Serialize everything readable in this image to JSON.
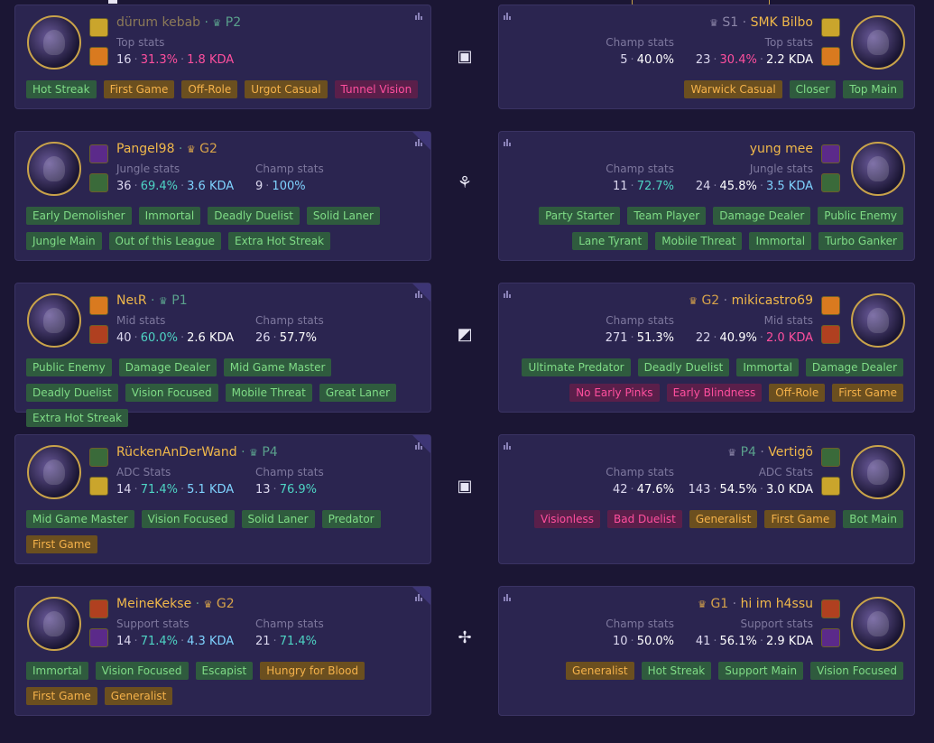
{
  "matchups": [
    {
      "role_glyph": "▣",
      "left": {
        "name": "dürum kebab",
        "rank": "P2",
        "rank_color": "#5aa08c",
        "name_dim": true,
        "role_label": "Top stats",
        "champ_label": "",
        "role_games": "16",
        "role_wr": "31.3%",
        "role_kda": "1.8 KDA",
        "champ_games": "",
        "champ_wr": "",
        "tags": [
          {
            "t": "Hot Streak",
            "c": "g"
          },
          {
            "t": "First Game",
            "c": "o"
          },
          {
            "t": "Off-Role",
            "c": "o"
          },
          {
            "t": "Urgot Casual",
            "c": "o"
          },
          {
            "t": "Tunnel Vision",
            "c": "p"
          }
        ]
      },
      "right": {
        "name": "SMK Bilbo",
        "rank": "S1",
        "rank_color": "#8c86a8",
        "role_label": "Top stats",
        "champ_label": "Champ stats",
        "role_games": "23",
        "role_wr": "30.4%",
        "role_kda": "2.2 KDA",
        "champ_games": "5",
        "champ_wr": "40.0%",
        "tags": [
          {
            "t": "Warwick Casual",
            "c": "o"
          },
          {
            "t": "Closer",
            "c": "g"
          },
          {
            "t": "Top Main",
            "c": "g"
          }
        ]
      }
    },
    {
      "role_glyph": "⚘",
      "left": {
        "name": "Pangel98",
        "rank": "G2",
        "role_label": "Jungle stats",
        "champ_label": "Champ stats",
        "role_games": "36",
        "role_wr": "69.4%",
        "role_kda": "3.6 KDA",
        "champ_games": "9",
        "champ_wr": "100%",
        "tags": [
          {
            "t": "Early Demolisher",
            "c": "g"
          },
          {
            "t": "Immortal",
            "c": "g"
          },
          {
            "t": "Deadly Duelist",
            "c": "g"
          },
          {
            "t": "Solid Laner",
            "c": "g"
          },
          {
            "t": "Jungle Main",
            "c": "g"
          },
          {
            "t": "Out of this League",
            "c": "g"
          },
          {
            "t": "Extra Hot Streak",
            "c": "g"
          }
        ]
      },
      "right": {
        "name": "yung mee",
        "rank": "",
        "role_label": "Jungle stats",
        "champ_label": "Champ stats",
        "role_games": "24",
        "role_wr": "45.8%",
        "role_kda": "3.5 KDA",
        "champ_games": "11",
        "champ_wr": "72.7%",
        "tags": [
          {
            "t": "Party Starter",
            "c": "g"
          },
          {
            "t": "Team Player",
            "c": "g"
          },
          {
            "t": "Damage Dealer",
            "c": "g"
          },
          {
            "t": "Public Enemy",
            "c": "g"
          },
          {
            "t": "Lane Tyrant",
            "c": "g"
          },
          {
            "t": "Mobile Threat",
            "c": "g"
          },
          {
            "t": "Immortal",
            "c": "g"
          },
          {
            "t": "Turbo Ganker",
            "c": "g"
          }
        ]
      }
    },
    {
      "role_glyph": "◩",
      "left": {
        "name": "NeιR",
        "rank": "P1",
        "role_label": "Mid stats",
        "champ_label": "Champ stats",
        "role_games": "40",
        "role_wr": "60.0%",
        "role_kda": "2.6 KDA",
        "champ_games": "26",
        "champ_wr": "57.7%",
        "tags": [
          {
            "t": "Public Enemy",
            "c": "g"
          },
          {
            "t": "Damage Dealer",
            "c": "g"
          },
          {
            "t": "Mid Game Master",
            "c": "g"
          },
          {
            "t": "Deadly Duelist",
            "c": "g"
          },
          {
            "t": "Vision Focused",
            "c": "g"
          },
          {
            "t": "Mobile Threat",
            "c": "g"
          },
          {
            "t": "Great Laner",
            "c": "g"
          },
          {
            "t": "Extra Hot Streak",
            "c": "g"
          }
        ]
      },
      "right": {
        "name": "mikicastro69",
        "rank": "G2",
        "role_label": "Mid stats",
        "champ_label": "Champ stats",
        "role_games": "22",
        "role_wr": "40.9%",
        "role_kda": "2.0 KDA",
        "champ_games": "271",
        "champ_wr": "51.3%",
        "tags": [
          {
            "t": "Ultimate Predator",
            "c": "g"
          },
          {
            "t": "Deadly Duelist",
            "c": "g"
          },
          {
            "t": "Immortal",
            "c": "g"
          },
          {
            "t": "Damage Dealer",
            "c": "g"
          },
          {
            "t": "No Early Pinks",
            "c": "p"
          },
          {
            "t": "Early Blindness",
            "c": "p"
          },
          {
            "t": "Off-Role",
            "c": "o"
          },
          {
            "t": "First Game",
            "c": "o"
          }
        ]
      }
    },
    {
      "role_glyph": "▣",
      "left": {
        "name": "RückenAnDerWand",
        "rank": "P4",
        "role_label": "ADC Stats",
        "champ_label": "Champ stats",
        "role_games": "14",
        "role_wr": "71.4%",
        "role_kda": "5.1 KDA",
        "champ_games": "13",
        "champ_wr": "76.9%",
        "tags": [
          {
            "t": "Mid Game Master",
            "c": "g"
          },
          {
            "t": "Vision Focused",
            "c": "g"
          },
          {
            "t": "Solid Laner",
            "c": "g"
          },
          {
            "t": "Predator",
            "c": "g"
          },
          {
            "t": "First Game",
            "c": "o"
          }
        ]
      },
      "right": {
        "name": "Vertigõ",
        "rank": "P4",
        "role_label": "ADC Stats",
        "champ_label": "Champ stats",
        "role_games": "143",
        "role_wr": "54.5%",
        "role_kda": "3.0 KDA",
        "champ_games": "42",
        "champ_wr": "47.6%",
        "tags": [
          {
            "t": "Visionless",
            "c": "p"
          },
          {
            "t": "Bad Duelist",
            "c": "p"
          },
          {
            "t": "Generalist",
            "c": "o"
          },
          {
            "t": "First Game",
            "c": "o"
          },
          {
            "t": "Bot Main",
            "c": "g"
          }
        ]
      }
    },
    {
      "role_glyph": "✢",
      "left": {
        "name": "MeineKekse",
        "rank": "G2",
        "role_label": "Support stats",
        "champ_label": "Champ stats",
        "role_games": "14",
        "role_wr": "71.4%",
        "role_kda": "4.3 KDA",
        "champ_games": "21",
        "champ_wr": "71.4%",
        "tags": [
          {
            "t": "Immortal",
            "c": "g"
          },
          {
            "t": "Vision Focused",
            "c": "g"
          },
          {
            "t": "Escapist",
            "c": "g"
          },
          {
            "t": "Hungry for Blood",
            "c": "o"
          },
          {
            "t": "First Game",
            "c": "o"
          },
          {
            "t": "Generalist",
            "c": "o"
          }
        ]
      },
      "right": {
        "name": "hi im h4ssu",
        "rank": "G1",
        "role_label": "Support stats",
        "champ_label": "Champ stats",
        "role_games": "41",
        "role_wr": "56.1%",
        "role_kda": "2.9 KDA",
        "champ_games": "10",
        "champ_wr": "50.0%",
        "tags": [
          {
            "t": "Generalist",
            "c": "o"
          },
          {
            "t": "Hot Streak",
            "c": "g"
          },
          {
            "t": "Support Main",
            "c": "g"
          },
          {
            "t": "Vision Focused",
            "c": "g"
          }
        ]
      }
    }
  ],
  "icons": {
    "stats_toggle": "bar-chart-icon",
    "rank_emblem": "laurel-icon"
  },
  "colors": {
    "background": "#1b1634",
    "card": "#2b2550",
    "name": "#f0b84a",
    "tag_positive": "#7fdc86",
    "tag_neutral": "#f5b24a",
    "tag_negative": "#ff4f9e",
    "win_rate_high": "#4ed4c4",
    "win_rate_low": "#ff4f9e"
  }
}
